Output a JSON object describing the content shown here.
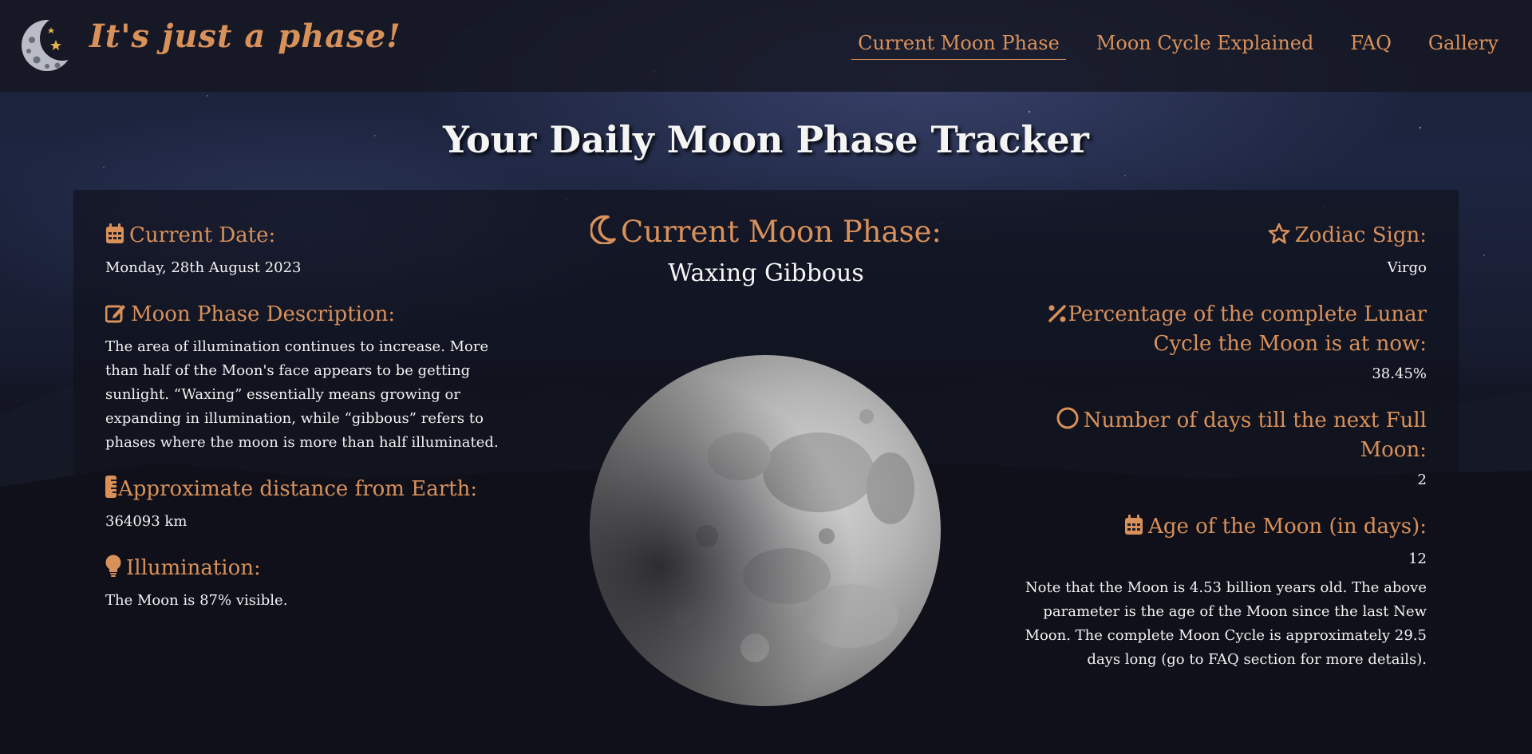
{
  "header": {
    "brand": "It's just a phase!",
    "logo_icon": "crescent-moon-logo-icon",
    "nav": [
      {
        "label": "Current Moon Phase",
        "active": true
      },
      {
        "label": "Moon Cycle Explained",
        "active": false
      },
      {
        "label": "FAQ",
        "active": false
      },
      {
        "label": "Gallery",
        "active": false
      }
    ]
  },
  "page": {
    "title": "Your Daily Moon Phase Tracker"
  },
  "left": {
    "date_heading": "Current Date:",
    "date_value": "Monday, 28th August 2023",
    "description_heading": "Moon Phase Description:",
    "description_value": "The area of illumination continues to increase. More than half of the Moon's face appears to be getting sunlight. “Waxing” essentially means growing or expanding in illumination, while “gibbous” refers to phases where the moon is more than half illuminated.",
    "distance_heading": "Approximate distance from Earth:",
    "distance_value": "364093 km",
    "illumination_heading": "Illumination:",
    "illumination_value": "The Moon is 87% visible."
  },
  "center": {
    "phase_heading": "Current Moon Phase:",
    "phase_name": "Waxing Gibbous",
    "illumination_fraction": 0.87
  },
  "right": {
    "zodiac_heading": "Zodiac Sign:",
    "zodiac_value": "Virgo",
    "percentage_heading": "Percentage of the complete Lunar Cycle the Moon is at now:",
    "percentage_value": "38.45%",
    "fullmoon_heading": "Number of days till the next Full Moon:",
    "fullmoon_value": "2",
    "age_heading": "Age of the Moon (in days):",
    "age_value": "12",
    "age_note": "Note that the Moon is 4.53 billion years old. The above parameter is the age of the Moon since the last New Moon. The complete Moon Cycle is approximately 29.5 days long (go to FAQ section for more details)."
  },
  "colors": {
    "accent": "#d9915a",
    "text": "#f2f2f2",
    "panel": "#0e101a"
  },
  "icons": {
    "date": "calendar-icon",
    "description": "edit-icon",
    "distance": "ruler-icon",
    "illumination": "lightbulb-icon",
    "phase": "crescent-moon-icon",
    "zodiac": "star-icon",
    "percentage": "percent-icon",
    "fullmoon": "circle-icon",
    "age": "calendar-icon"
  }
}
